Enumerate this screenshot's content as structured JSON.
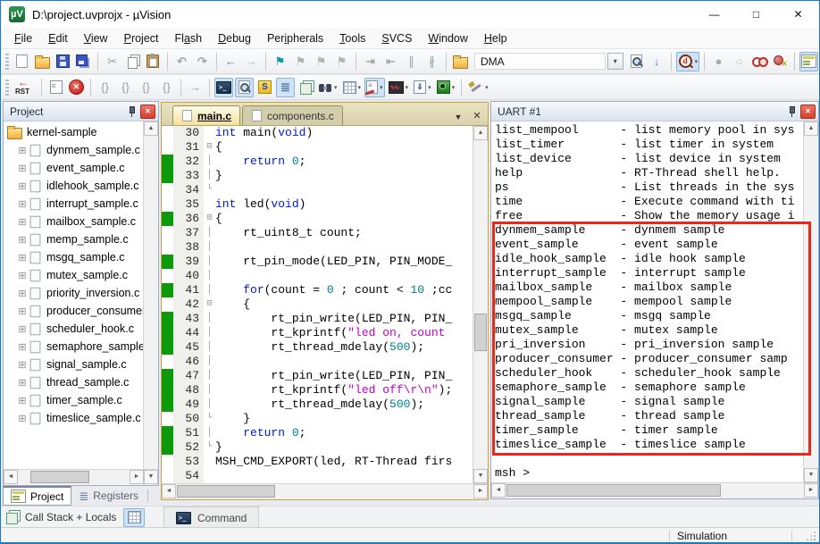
{
  "window": {
    "title": "D:\\project.uvprojx - µVision",
    "icon_label": "µV",
    "controls": {
      "minimize": "—",
      "maximize": "□",
      "close": "✕"
    }
  },
  "menu": [
    {
      "label": "File",
      "u": 0
    },
    {
      "label": "Edit",
      "u": 0
    },
    {
      "label": "View",
      "u": 0
    },
    {
      "label": "Project",
      "u": 0
    },
    {
      "label": "Flash",
      "u": 2
    },
    {
      "label": "Debug",
      "u": 0
    },
    {
      "label": "Peripherals",
      "u": 3
    },
    {
      "label": "Tools",
      "u": 0
    },
    {
      "label": "SVCS",
      "u": 0
    },
    {
      "label": "Window",
      "u": 0
    },
    {
      "label": "Help",
      "u": 0
    }
  ],
  "search": {
    "value": "DMA"
  },
  "toolbar1": [
    {
      "n": "new-file",
      "cls": "page"
    },
    {
      "n": "open-file",
      "cls": "folder"
    },
    {
      "n": "save",
      "cls": "floppy"
    },
    {
      "n": "save-all",
      "cls": "floppy2"
    },
    {
      "t": "sep"
    },
    {
      "n": "cut",
      "g": "✂",
      "c": "#98a0a8"
    },
    {
      "n": "copy",
      "cls": "copy"
    },
    {
      "n": "paste",
      "cls": "paste"
    },
    {
      "t": "sep"
    },
    {
      "n": "undo",
      "g": "↶",
      "c": "#a0a8b0",
      "b": 1
    },
    {
      "n": "redo",
      "g": "↷",
      "c": "#a0a8b0",
      "b": 1
    },
    {
      "t": "sep"
    },
    {
      "n": "navigate-back",
      "g": "←",
      "c": "#4a80c8",
      "b": 1
    },
    {
      "n": "navigate-forward",
      "g": "→",
      "c": "#b4b8bc",
      "b": 1
    },
    {
      "t": "sep"
    },
    {
      "n": "insert-bookmark",
      "g": "⚑",
      "c": "#0e98a8"
    },
    {
      "n": "goto-next-bookmark",
      "g": "⚑",
      "c": "#b0b4b8"
    },
    {
      "n": "goto-previous-bookmark",
      "g": "⚑",
      "c": "#b0b4b8"
    },
    {
      "n": "clear-all-bookmarks",
      "g": "⚑",
      "c": "#b0b4b8"
    },
    {
      "t": "sep"
    },
    {
      "n": "indent",
      "g": "⇥",
      "c": "#8a929a"
    },
    {
      "n": "unindent",
      "g": "⇤",
      "c": "#8a929a"
    },
    {
      "n": "comment-selection",
      "g": "∥",
      "c": "#9aa2aa"
    },
    {
      "n": "uncomment-selection",
      "g": "∦",
      "c": "#9aa2aa"
    },
    {
      "t": "sep"
    },
    {
      "n": "find-in-files-scope",
      "cls": "folder"
    },
    {
      "t": "combo",
      "n": "search"
    },
    {
      "n": "find-in-files",
      "cls": "magpage"
    },
    {
      "n": "incremental-find",
      "g": "↓",
      "c": "#4a80c8",
      "b": 1
    },
    {
      "t": "sep"
    },
    {
      "n": "find-all-references",
      "cls": "magd",
      "box": 1,
      "dd": 1
    },
    {
      "t": "sep"
    },
    {
      "n": "toggle-breakpoint",
      "g": "●",
      "c": "#a8a8a8"
    },
    {
      "n": "enable-disable-breakpoint",
      "g": "○",
      "c": "#b8b8b8"
    },
    {
      "n": "disable-all-breakpoints",
      "cls": "redcircles"
    },
    {
      "n": "kill-all-breakpoints",
      "cls": "redcirclex"
    },
    {
      "t": "sep"
    },
    {
      "n": "project-window-toggle",
      "cls": "winicon",
      "box": 1
    }
  ],
  "toolbar2": [
    {
      "n": "reset",
      "cls": "rst"
    },
    {
      "t": "sep"
    },
    {
      "n": "run",
      "cls": "runlist"
    },
    {
      "n": "stop",
      "cls": "stopx"
    },
    {
      "t": "sep"
    },
    {
      "n": "step",
      "g": "{}",
      "c": "#9aa2aa"
    },
    {
      "n": "step-over",
      "g": "{}",
      "c": "#9aa2aa"
    },
    {
      "n": "step-out",
      "g": "{}",
      "c": "#9aa2aa"
    },
    {
      "n": "run-to-cursor-line",
      "g": "{}",
      "c": "#9aa2aa"
    },
    {
      "t": "sep"
    },
    {
      "n": "show-next-statement",
      "g": "→",
      "c": "#98a890",
      "b": 1
    },
    {
      "t": "sep"
    },
    {
      "n": "command-window",
      "cls": "term",
      "box": 1
    },
    {
      "n": "disassembly-window",
      "cls": "magpage",
      "box": 1
    },
    {
      "n": "symbol-window",
      "cls": "sym"
    },
    {
      "n": "registers-window",
      "g": "≣",
      "c": "#5878a8",
      "box": 1,
      "b": 1
    },
    {
      "n": "call-stack-window",
      "cls": "callstack"
    },
    {
      "n": "watch-windows",
      "cls": "bino",
      "dd": 1
    },
    {
      "n": "memory-windows",
      "cls": "grid",
      "dd": 1
    },
    {
      "n": "serial-windows",
      "cls": "serial",
      "box": 1,
      "dd": 1
    },
    {
      "n": "analysis-windows",
      "cls": "wave",
      "dd": 1
    },
    {
      "n": "trace-windows",
      "cls": "trace",
      "dd": 1
    },
    {
      "n": "system-viewer",
      "cls": "sysview",
      "dd": 1
    },
    {
      "t": "sep"
    },
    {
      "n": "toolbox",
      "cls": "tools",
      "dd": 1
    }
  ],
  "project": {
    "title": "Project",
    "root": "kernel-sample",
    "files": [
      "dynmem_sample.c",
      "event_sample.c",
      "idlehook_sample.c",
      "interrupt_sample.c",
      "mailbox_sample.c",
      "memp_sample.c",
      "msgq_sample.c",
      "mutex_sample.c",
      "priority_inversion.c",
      "producer_consumer.c",
      "scheduler_hook.c",
      "semaphore_sample.c",
      "signal_sample.c",
      "thread_sample.c",
      "timer_sample.c",
      "timeslice_sample.c"
    ]
  },
  "editor": {
    "tabs": [
      {
        "label": "main.c"
      },
      {
        "label": "components.c"
      }
    ],
    "lines": [
      {
        "n": 30,
        "f": "",
        "seg": [
          [
            "k",
            "int"
          ],
          [
            "p",
            " main("
          ],
          [
            "k",
            "void"
          ],
          [
            "p",
            ")"
          ]
        ]
      },
      {
        "n": 31,
        "f": "⊟",
        "seg": [
          [
            "p",
            "{"
          ]
        ]
      },
      {
        "n": 32,
        "g": 1,
        "f": "│",
        "seg": [
          [
            "p",
            "    "
          ],
          [
            "k",
            "return"
          ],
          [
            "p",
            " "
          ],
          [
            "n",
            "0"
          ],
          [
            "p",
            ";"
          ]
        ]
      },
      {
        "n": 33,
        "g": 1,
        "f": "│",
        "seg": [
          [
            "p",
            "}"
          ]
        ]
      },
      {
        "n": 34,
        "f": "└",
        "seg": []
      },
      {
        "n": 35,
        "f": "",
        "seg": [
          [
            "k",
            "int"
          ],
          [
            "p",
            " led("
          ],
          [
            "k",
            "void"
          ],
          [
            "p",
            ")"
          ]
        ]
      },
      {
        "n": 36,
        "g": 1,
        "f": "⊟",
        "seg": [
          [
            "p",
            "{"
          ]
        ]
      },
      {
        "n": 37,
        "f": "│",
        "seg": [
          [
            "p",
            "    rt_uint8_t count;"
          ]
        ]
      },
      {
        "n": 38,
        "f": "│",
        "seg": []
      },
      {
        "n": 39,
        "g": 1,
        "f": "│",
        "seg": [
          [
            "p",
            "    rt_pin_mode(LED_PIN, PIN_MODE_"
          ]
        ]
      },
      {
        "n": 40,
        "f": "│",
        "seg": []
      },
      {
        "n": 41,
        "g": 1,
        "f": "│",
        "seg": [
          [
            "p",
            "    "
          ],
          [
            "k",
            "for"
          ],
          [
            "p",
            "(count = "
          ],
          [
            "n",
            "0"
          ],
          [
            "p",
            " ; count < "
          ],
          [
            "n",
            "10"
          ],
          [
            "p",
            " ;cc"
          ]
        ]
      },
      {
        "n": 42,
        "f": "⊟",
        "seg": [
          [
            "p",
            "    {"
          ]
        ]
      },
      {
        "n": 43,
        "g": 1,
        "f": "│",
        "seg": [
          [
            "p",
            "        rt_pin_write(LED_PIN, PIN_"
          ]
        ]
      },
      {
        "n": 44,
        "g": 1,
        "f": "│",
        "seg": [
          [
            "p",
            "        rt_kprintf("
          ],
          [
            "s",
            "\"led on, count "
          ]
        ]
      },
      {
        "n": 45,
        "g": 1,
        "f": "│",
        "seg": [
          [
            "p",
            "        rt_thread_mdelay("
          ],
          [
            "n",
            "500"
          ],
          [
            "p",
            ");"
          ]
        ]
      },
      {
        "n": 46,
        "f": "│",
        "seg": []
      },
      {
        "n": 47,
        "g": 1,
        "f": "│",
        "seg": [
          [
            "p",
            "        rt_pin_write(LED_PIN, PIN_"
          ]
        ]
      },
      {
        "n": 48,
        "g": 1,
        "f": "│",
        "seg": [
          [
            "p",
            "        rt_kprintf("
          ],
          [
            "s",
            "\"led off\\r\\n\""
          ],
          [
            "p",
            ");"
          ]
        ]
      },
      {
        "n": 49,
        "g": 1,
        "f": "│",
        "seg": [
          [
            "p",
            "        rt_thread_mdelay("
          ],
          [
            "n",
            "500"
          ],
          [
            "p",
            ");"
          ]
        ]
      },
      {
        "n": 50,
        "f": "└",
        "seg": [
          [
            "p",
            "    }"
          ]
        ]
      },
      {
        "n": 51,
        "g": 1,
        "f": "│",
        "seg": [
          [
            "p",
            "    "
          ],
          [
            "k",
            "return"
          ],
          [
            "p",
            " "
          ],
          [
            "n",
            "0"
          ],
          [
            "p",
            ";"
          ]
        ]
      },
      {
        "n": 52,
        "g": 1,
        "f": "└",
        "seg": [
          [
            "p",
            "}"
          ]
        ]
      },
      {
        "n": 53,
        "f": "",
        "seg": [
          [
            "p",
            "MSH_CMD_EXPORT(led, RT-Thread firs"
          ]
        ]
      },
      {
        "n": 54,
        "f": "",
        "seg": []
      }
    ]
  },
  "uart": {
    "title": "UART #1",
    "lines": [
      "list_mempool      - list memory pool in sys",
      "list_timer        - list timer in system",
      "list_device       - list device in system",
      "help              - RT-Thread shell help.",
      "ps                - List threads in the sys",
      "time              - Execute command with ti",
      "free              - Show the memory usage i",
      "dynmem_sample     - dynmem sample",
      "event_sample      - event sample",
      "idle_hook_sample  - idle hook sample",
      "interrupt_sample  - interrupt sample",
      "mailbox_sample    - mailbox sample",
      "mempool_sample    - mempool sample",
      "msgq_sample       - msgq sample",
      "mutex_sample      - mutex sample",
      "pri_inversion     - pri_inversion sample",
      "producer_consumer - producer_consumer samp",
      "scheduler_hook    - scheduler_hook sample",
      "semaphore_sample  - semaphore sample",
      "signal_sample     - signal sample",
      "thread_sample     - thread sample",
      "timer_sample      - timer sample",
      "timeslice_sample  - timeslice sample",
      "",
      "msh >"
    ]
  },
  "bottom": {
    "project_tab": "Project",
    "registers_tab": "Registers",
    "callstack": "Call Stack + Locals",
    "command": "Command"
  },
  "statusbar": {
    "mode": "Simulation"
  }
}
